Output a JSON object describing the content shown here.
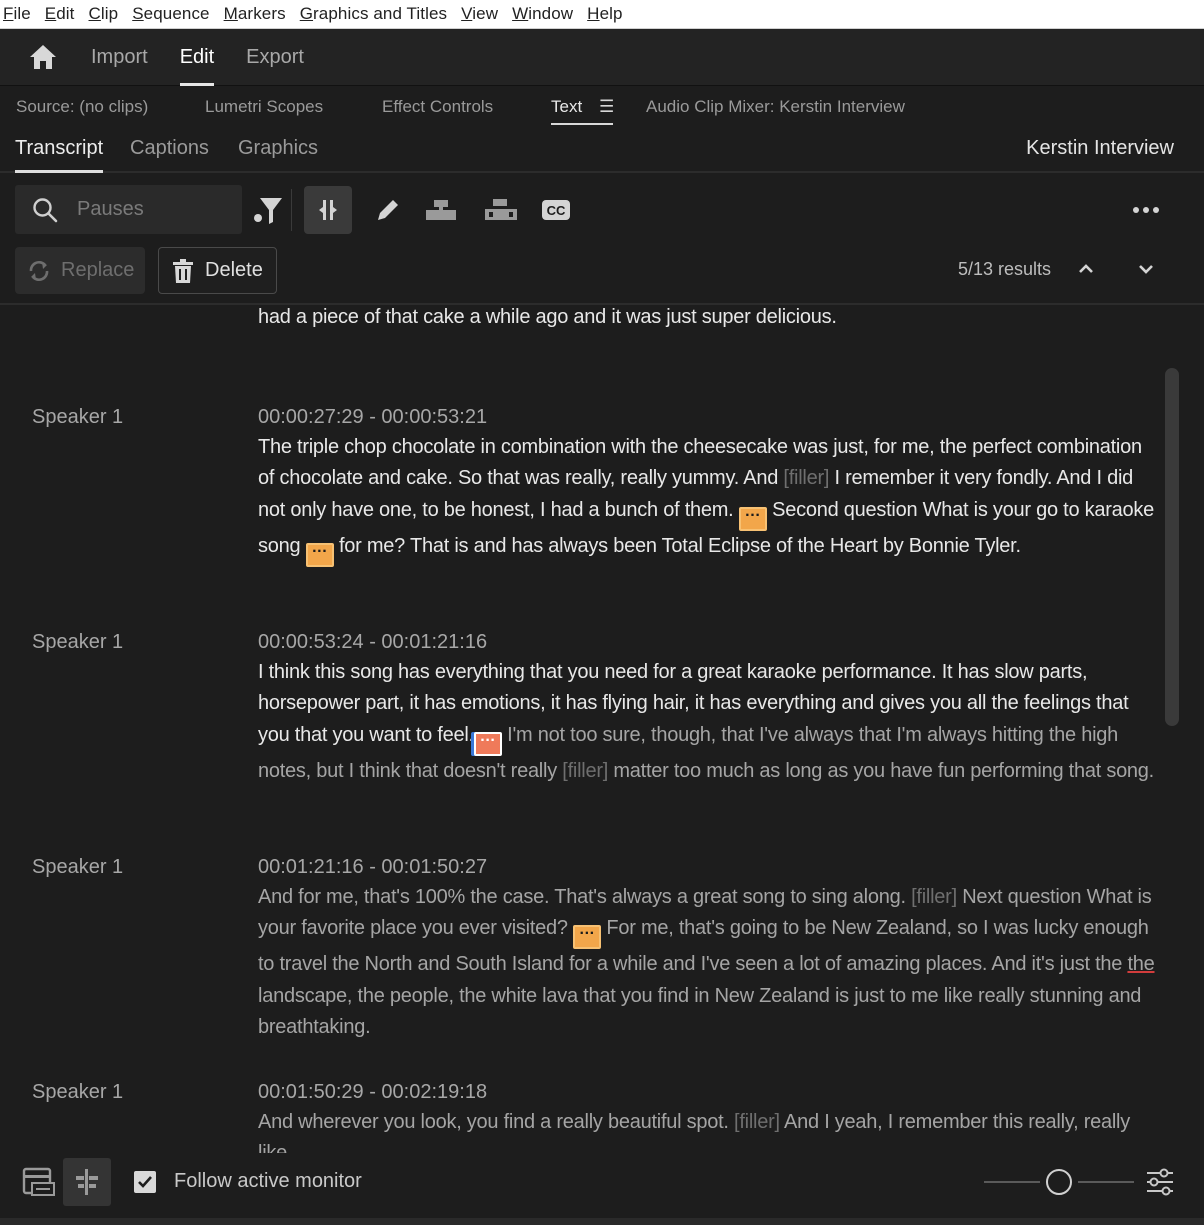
{
  "menu": [
    "File",
    "Edit",
    "Clip",
    "Sequence",
    "Markers",
    "Graphics and Titles",
    "View",
    "Window",
    "Help"
  ],
  "workspace": {
    "tabs": [
      "Import",
      "Edit",
      "Export"
    ],
    "active": "Edit"
  },
  "panel_tabs": {
    "source": "Source: (no clips)",
    "scopes": "Lumetri Scopes",
    "effects": "Effect Controls",
    "text": "Text",
    "mixer": "Audio Clip Mixer: Kerstin Interview"
  },
  "sub_tabs": {
    "transcript": "Transcript",
    "captions": "Captions",
    "graphics": "Graphics"
  },
  "sequence_name": "Kerstin Interview",
  "search": {
    "placeholder": "Pauses"
  },
  "actions": {
    "replace": "Replace",
    "delete": "Delete",
    "results": "5/13 results"
  },
  "pause_glyph": "···",
  "transcript": {
    "top_line": "had a piece of that cake a while ago and it was just super delicious.",
    "blocks": [
      {
        "speaker": "Speaker 1",
        "timecode": "00:00:27:29 - 00:00:53:21",
        "t1": "The triple chop chocolate in combination with the cheesecake was just, for me, the perfect combination of chocolate and cake. So that was really, really yummy. And ",
        "f1": "[filler]",
        "t2": " I remember it very fondly. And I did not only have one, to be honest, I had a bunch of them. ",
        "t3": " Second question What is your go to karaoke song ",
        "t4": " for me? That is and has always been Total Eclipse of the Heart by Bonnie Tyler."
      },
      {
        "speaker": "Speaker 1",
        "timecode": "00:00:53:24 - 00:01:21:16",
        "t1": "I think this song has everything that you need for a great karaoke performance. It has slow parts, horsepower part, it has emotions, it has flying hair, it has everything and gives you all the feelings that you that you want to feel.",
        "t2": " I'm not too sure, though, that I've always that I'm always hitting the high notes, but I think that doesn't really ",
        "f1": "[filler]",
        "t3": " matter too much as long as you have fun performing that song."
      },
      {
        "speaker": "Speaker 1",
        "timecode": "00:01:21:16 - 00:01:50:27",
        "t1": "And for me, that's 100% the case. That's always a great song to sing along. ",
        "f1": "[filler]",
        "t2": " Next question What is your favorite place you ever visited? ",
        "t3": " For me, that's going to be New Zealand, so I was lucky enough to travel the North and South Island for a while and I've seen a lot of amazing places. And it's just the ",
        "u1": "the",
        "t4": " landscape, the people, the white lava that you find in New Zealand is just to me like really stunning and breathtaking."
      },
      {
        "speaker": "Speaker 1",
        "timecode": "00:01:50:29 - 00:02:19:18",
        "t1": "And wherever you look, you find a really beautiful spot. ",
        "f1": "[filler]",
        "t2": " And I yeah, I remember this really, really like"
      }
    ]
  },
  "footer": {
    "follow": "Follow active monitor",
    "follow_checked": true,
    "zoom_level": 0.6
  },
  "colors": {
    "pause": "#f2a64a",
    "pause_active": "#ef7a5a",
    "filler": "#6f6f6f",
    "background": "#1d1d1d"
  }
}
